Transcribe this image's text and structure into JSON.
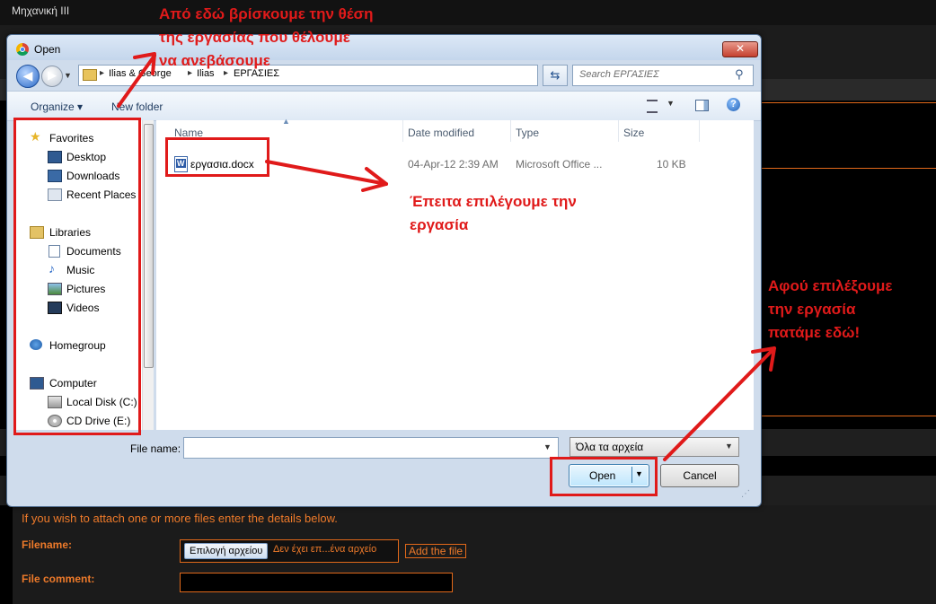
{
  "background_page": {
    "title": "Μηχανική ΙΙΙ",
    "attach_text": "If you wish to attach one or more files enter the details below.",
    "filename_label": "Filename:",
    "choose_file_label": "Επιλογή αρχείου",
    "no_file_text": "Δεν έχει επ...ένα αρχείο",
    "add_file_label": "Add the file",
    "file_comment_label": "File comment:",
    "file_comment_value": "",
    "accent_color": "#e2691a"
  },
  "dialog": {
    "title": "Open",
    "close_icon": "✕",
    "address": {
      "crumbs": [
        "Ilias & George",
        "Ilias",
        "ΕΡΓΑΣΙΕΣ"
      ],
      "separator": "▸"
    },
    "search_placeholder": "Search ΕΡΓΑΣΙΕΣ",
    "toolbar": {
      "organize_label": "Organize ▾",
      "new_folder_label": "New folder"
    },
    "nav": {
      "favorites": "Favorites",
      "desktop": "Desktop",
      "downloads": "Downloads",
      "recent_places": "Recent Places",
      "libraries": "Libraries",
      "documents": "Documents",
      "music": "Music",
      "pictures": "Pictures",
      "videos": "Videos",
      "homegroup": "Homegroup",
      "computer": "Computer",
      "local_disk": "Local Disk (C:)",
      "cd_drive": "CD Drive (E:)"
    },
    "columns": {
      "name": "Name",
      "date_modified": "Date modified",
      "type": "Type",
      "size": "Size"
    },
    "files": [
      {
        "name": "εργασια.docx",
        "date_modified": "04-Apr-12 2:39 AM",
        "type": "Microsoft Office ...",
        "size": "10 KB"
      }
    ],
    "file_name_label": "File name:",
    "file_name_value": "",
    "filter_value": "Όλα τα αρχεία",
    "open_label": "Open",
    "cancel_label": "Cancel"
  },
  "annotations": {
    "note_top_1": "Από εδώ βρίσκουμε την θέση",
    "note_top_2": "της εργασίας που θέλουμε",
    "note_top_3": "να ανεβάσουμε",
    "note_mid_1": "Έπειτα επιλέγουμε την",
    "note_mid_2": "εργασία",
    "note_right_1": "Αφού επιλέξουμε",
    "note_right_2": "την εργασία",
    "note_right_3": "πατάμε εδώ!",
    "color": "#e01a1a"
  }
}
